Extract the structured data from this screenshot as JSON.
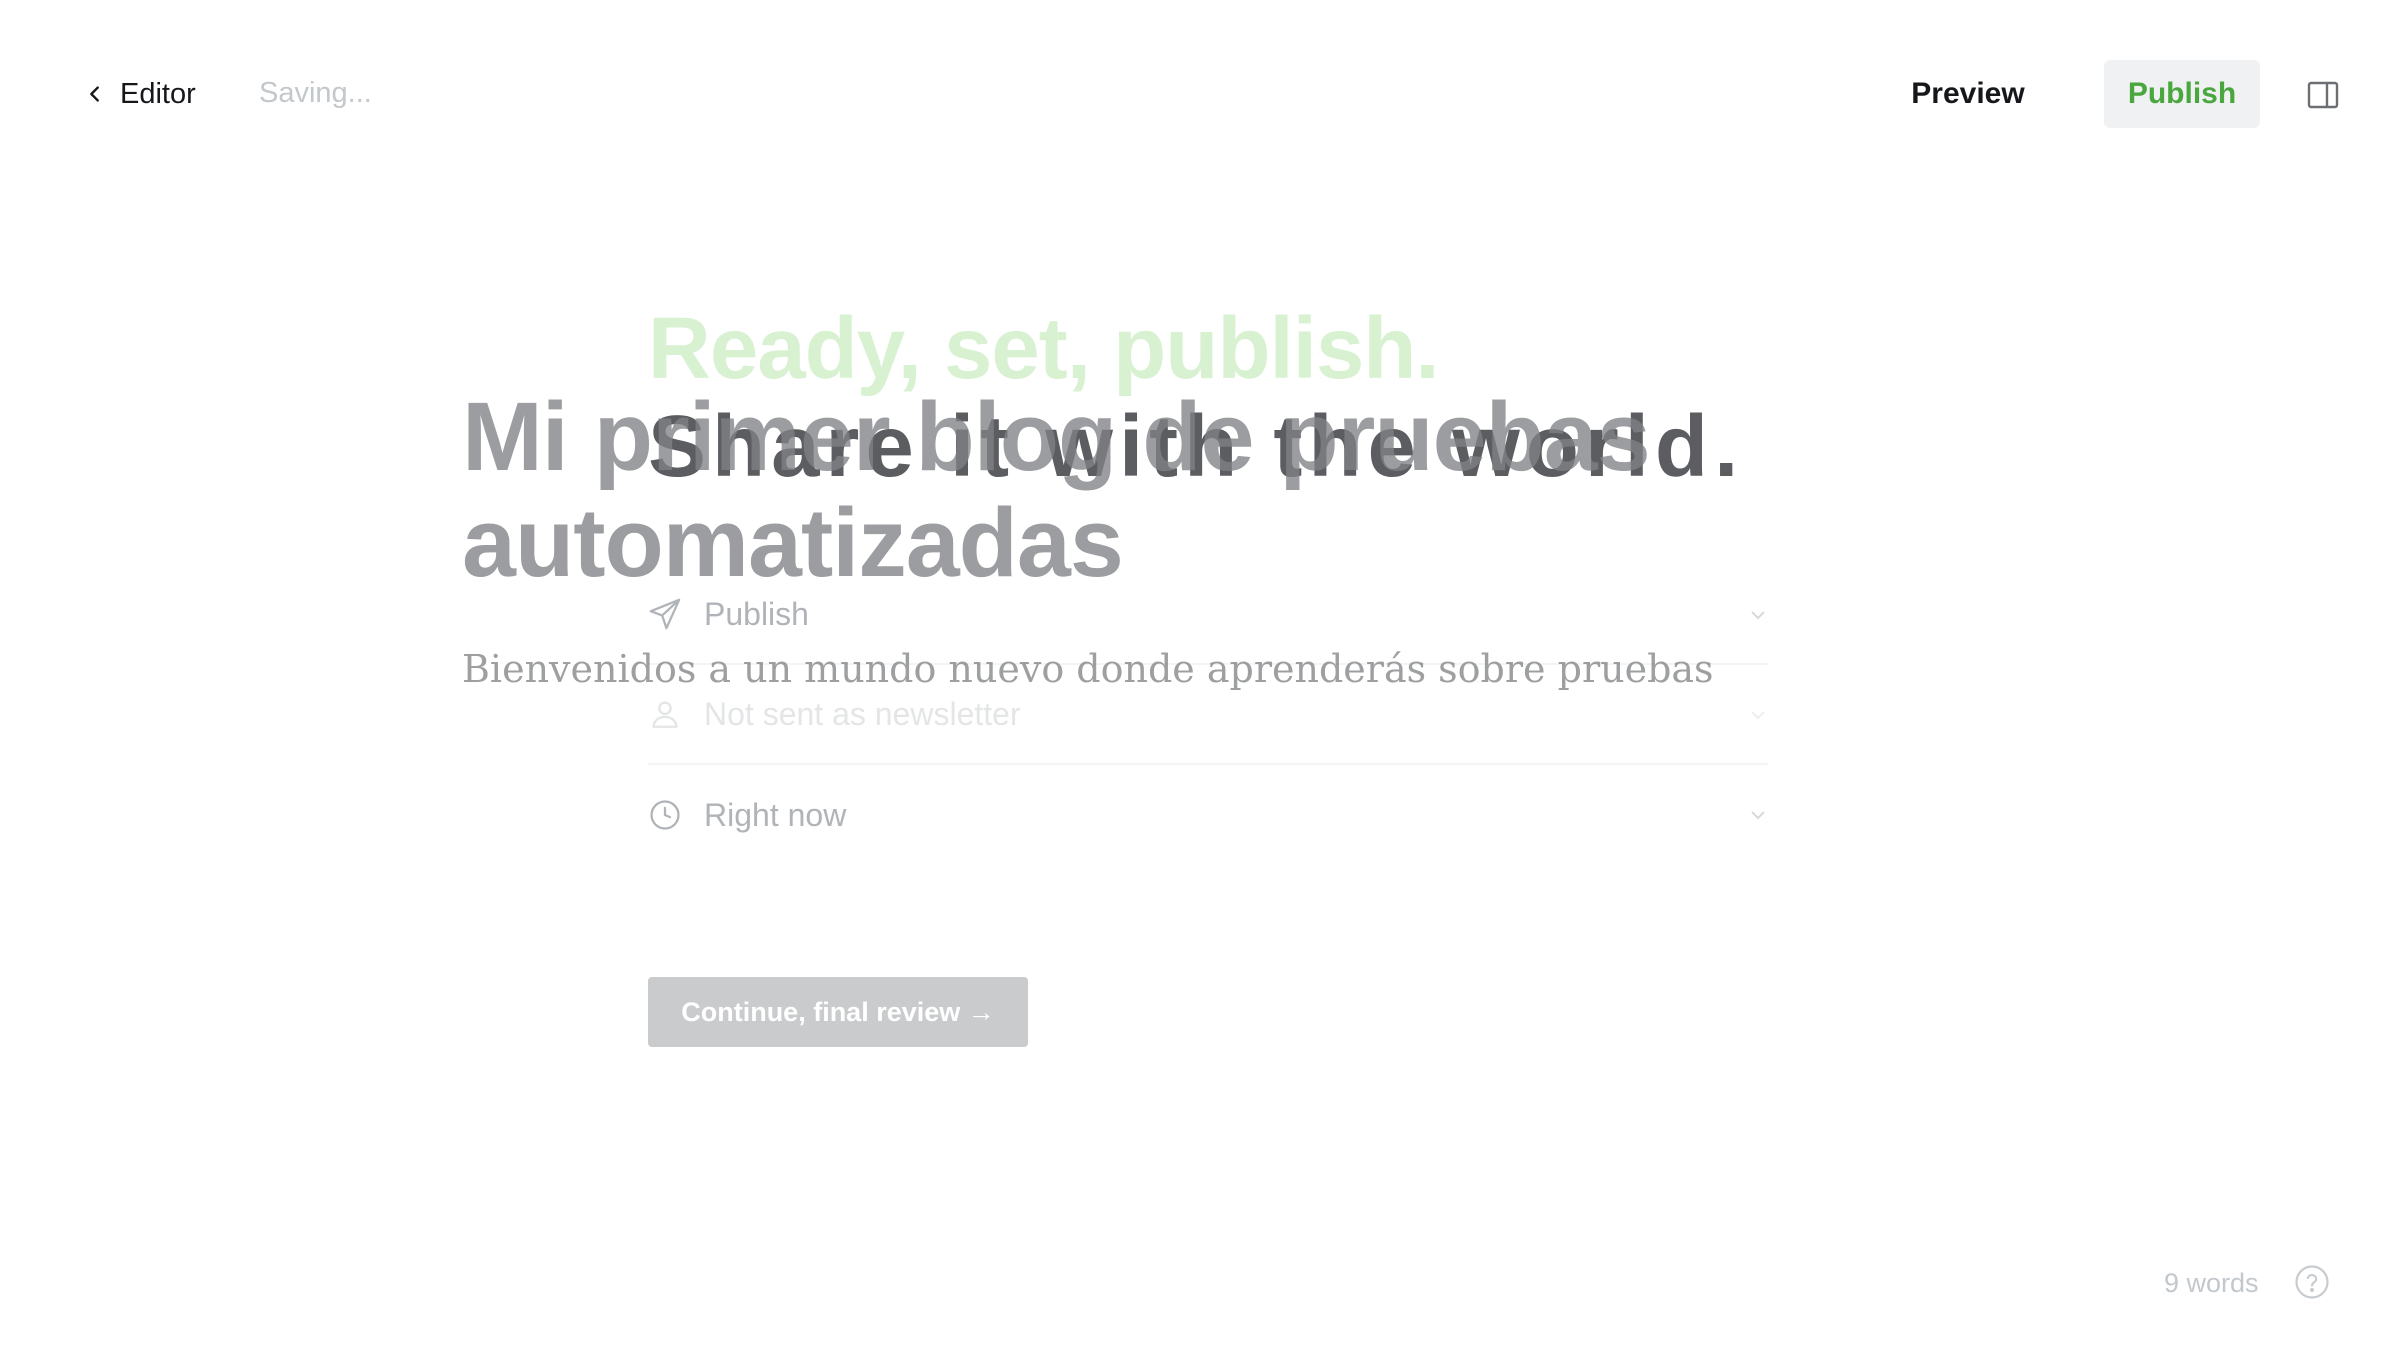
{
  "header": {
    "back_label": "Editor",
    "status": "Saving...",
    "preview_label": "Preview",
    "publish_label": "Publish"
  },
  "publish_flow": {
    "heading_line1": "Ready, set, publish.",
    "heading_line2": "Share it with the world.",
    "options": [
      {
        "label": "Publish",
        "icon": "send-icon"
      },
      {
        "label": "Not sent as newsletter",
        "icon": "user-icon"
      },
      {
        "label": "Right now",
        "icon": "clock-icon"
      }
    ],
    "continue_label": "Continue, final review →"
  },
  "post": {
    "title": "Mi primer blog de pruebas automatizadas",
    "excerpt": "Bienvenidos a un mundo nuevo donde aprenderás sobre pruebas"
  },
  "footer": {
    "word_count": "9 words"
  },
  "colors": {
    "accent_green": "#4aa63e",
    "heading_green": "#d7f1d1",
    "button_disabled": "#c9cbcd"
  }
}
